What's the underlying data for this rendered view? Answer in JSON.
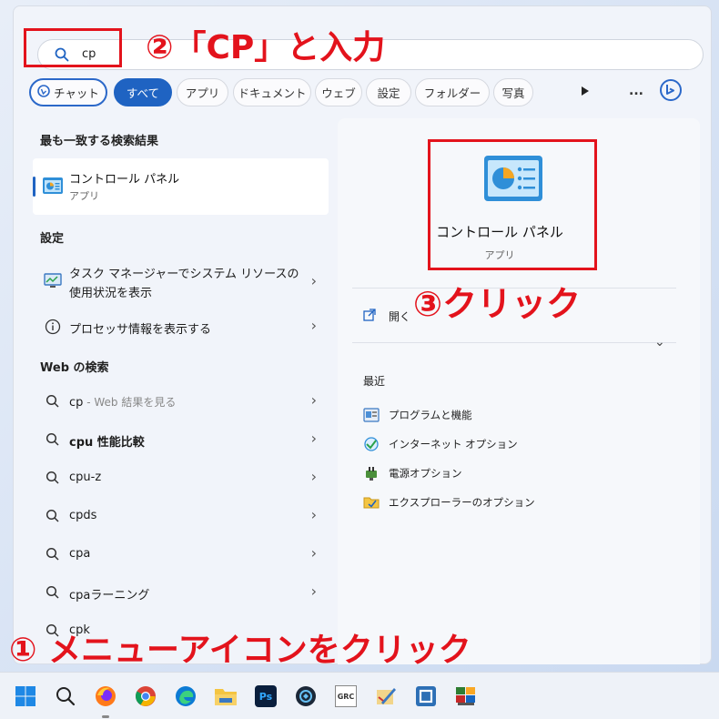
{
  "search": {
    "value": "cp"
  },
  "tabs": [
    "チャット",
    "すべて",
    "アプリ",
    "ドキュメント",
    "ウェブ",
    "設定",
    "フォルダー",
    "写真"
  ],
  "more_label": "...",
  "left": {
    "best_match_header": "最も一致する検索結果",
    "best_match": {
      "title": "コントロール パネル",
      "subtitle": "アプリ"
    },
    "settings_header": "設定",
    "settings_items": [
      {
        "line1": "タスク マネージャーでシステム リソースの",
        "line2": "使用状況を表示"
      },
      {
        "line1": "プロセッサ情報を表示する"
      }
    ],
    "web_header": "Web の検索",
    "web_items": [
      {
        "main": "cp",
        "suffix": " - Web 結果を見る"
      },
      {
        "main": "cpu 性能比較"
      },
      {
        "main": "cpu-z"
      },
      {
        "main": "cpds"
      },
      {
        "main": "cpa"
      },
      {
        "main": "cpaラーニング"
      },
      {
        "main": "cpk"
      }
    ]
  },
  "right": {
    "app_title": "コントロール パネル",
    "app_subtitle": "アプリ",
    "open_label": "開く",
    "recent_header": "最近",
    "recent_items": [
      "プログラムと機能",
      "インターネット オプション",
      "電源オプション",
      "エクスプローラーのオプション"
    ]
  },
  "annotations": {
    "step1": "① メニューアイコンをクリック",
    "step2": "②「CP」と入力",
    "step3": "③クリック"
  },
  "colors": {
    "accent": "#1f63c2",
    "annotation": "#e3131c"
  },
  "taskbar_icons": [
    "windows-start-icon",
    "search-icon",
    "firefox-icon",
    "chrome-icon",
    "edge-icon",
    "file-explorer-icon",
    "photoshop-icon",
    "app-icon",
    "app-icon",
    "app-icon",
    "app-icon",
    "app-icon"
  ],
  "taskbar_labels": {
    "photoshop": "Ps",
    "grc": "GRC"
  }
}
